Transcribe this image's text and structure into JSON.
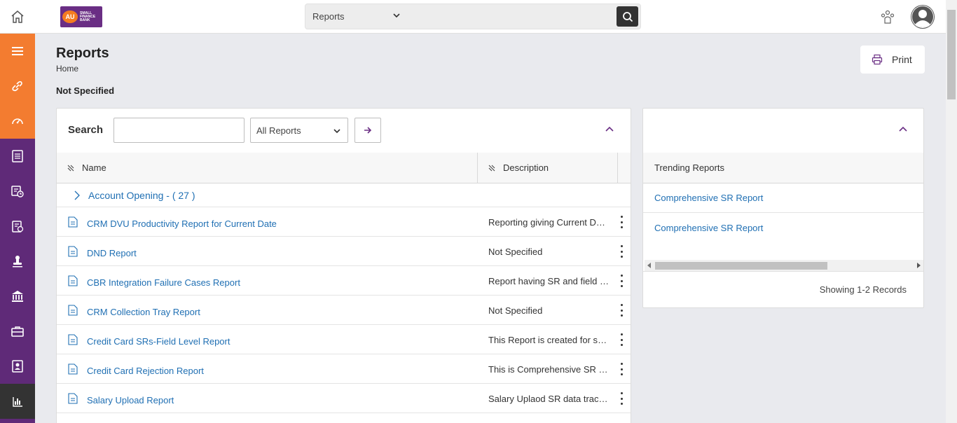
{
  "header": {
    "search_category": "Reports",
    "search_placeholder": ""
  },
  "sidebar": {
    "items": [
      "menu-icon",
      "link-icon",
      "dashboard-icon",
      "document-icon",
      "reports-chart-icon",
      "clipboard-icon",
      "stamp-icon",
      "bank-icon",
      "briefcase-icon",
      "contact-icon",
      "bar-chart-icon"
    ]
  },
  "page": {
    "title": "Reports",
    "breadcrumb": "Home",
    "subtitle": "Not Specified",
    "print_label": "Print"
  },
  "reports_panel": {
    "search_label": "Search",
    "search_value": "",
    "filter_selected": "All Reports",
    "columns": {
      "name": "Name",
      "description": "Description"
    },
    "group": "Account Opening - ( 27 )",
    "rows": [
      {
        "name": "CRM DVU Productivity Report for Current Date",
        "description": "Reporting giving Current Da…"
      },
      {
        "name": "DND Report",
        "description": "Not Specified"
      },
      {
        "name": "CBR Integration Failure Cases Report",
        "description": "Report having SR and field l…"
      },
      {
        "name": "CRM Collection Tray Report",
        "description": "Not Specified"
      },
      {
        "name": "Credit Card SRs-Field Level Report",
        "description": "This Report is created for sh…"
      },
      {
        "name": "Credit Card Rejection Report",
        "description": "This is Comprehensive SR R…"
      },
      {
        "name": "Salary Upload Report",
        "description": "Salary Uplaod SR data track…"
      }
    ]
  },
  "trending_panel": {
    "header": "Trending Reports",
    "items": [
      "Comprehensive SR Report",
      "Comprehensive SR Report"
    ],
    "records": "Showing 1-2 Records"
  },
  "colors": {
    "sidebar_purple": "#5f2a78",
    "sidebar_orange": "#f37c30",
    "link_blue": "#1f6fb3",
    "brand_purple": "#6a2e84"
  }
}
